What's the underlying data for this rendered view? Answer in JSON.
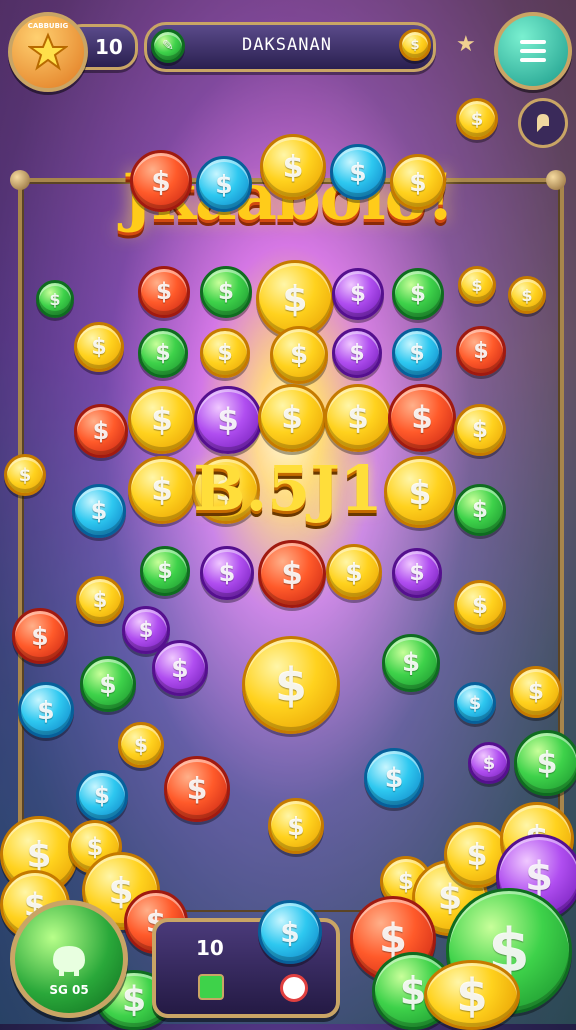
{
  "hud": {
    "badge_label": "CABBUBIG",
    "level_value": "10",
    "name_field": "DAKSANAN"
  },
  "title_text": "Jkaabolo!",
  "center_text": "B.5J1",
  "bottom": {
    "green_button_label": "SG 05",
    "panel_value": "10"
  },
  "colors": {
    "accent": "#ffcc1a",
    "frame": "#a8864c",
    "panel": "#2a2050"
  },
  "icons": {
    "star": "star-icon",
    "menu": "menu-icon",
    "info": "info-icon",
    "coin": "coin-icon"
  }
}
